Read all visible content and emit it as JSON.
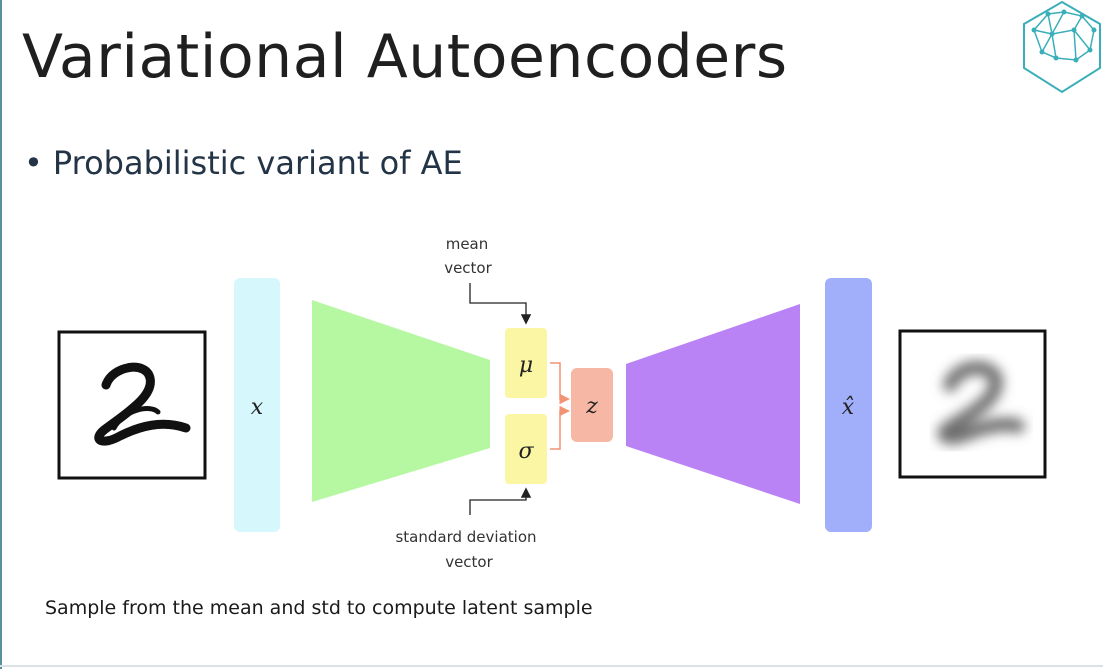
{
  "slide": {
    "title": "Variational Autoencoders",
    "bullet": "Probabilistic variant of AE",
    "caption": "Sample from the mean and std to compute latent sample"
  },
  "diagram": {
    "labels": {
      "mean_line1": "mean",
      "mean_line2": "vector",
      "std_line1": "standard deviation",
      "std_line2": "vector",
      "input_symbol": "x",
      "mu_symbol": "μ",
      "sigma_symbol": "σ",
      "latent_symbol": "z",
      "output_symbol": "x̂"
    },
    "colors": {
      "input_bar": "#d6f7fc",
      "encoder": "#b6f7a2",
      "mu_sigma": "#fbf6a4",
      "latent": "#f6b7a4",
      "decoder": "#b983f5",
      "output_bar": "#a1aefa",
      "arrow": "#f29474",
      "logo": "#3aafb9"
    },
    "icons": {
      "input_image": "handwritten-digit-2",
      "output_image": "blurry-digit-2",
      "logo": "brain-hexagon-icon"
    }
  }
}
